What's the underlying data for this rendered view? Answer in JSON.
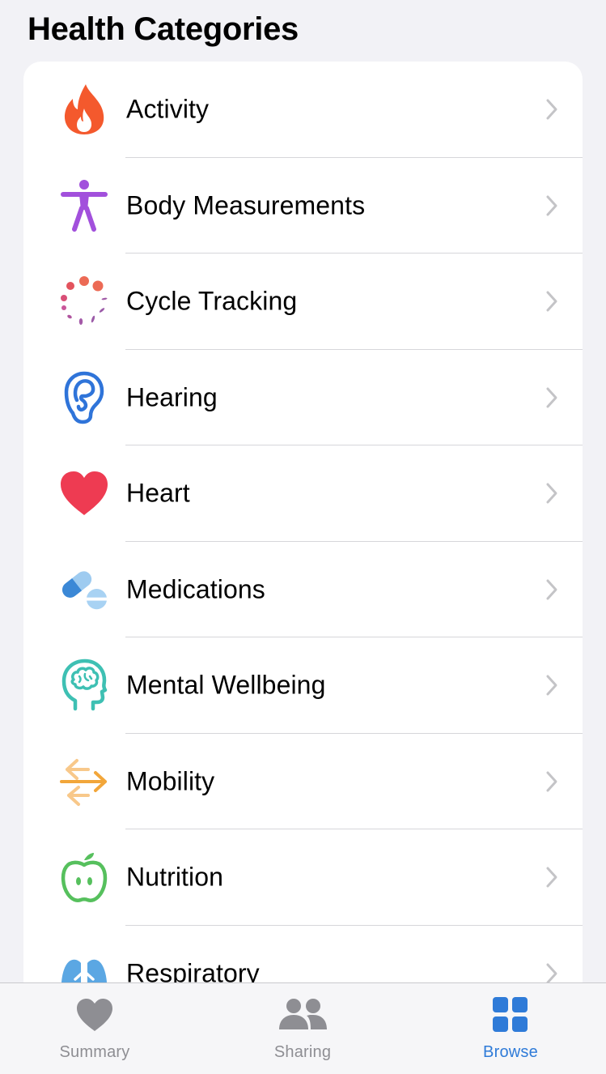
{
  "header": {
    "title": "Health Categories"
  },
  "categories": [
    {
      "label": "Activity",
      "icon": "flame-icon",
      "color": "#f4592d"
    },
    {
      "label": "Body Measurements",
      "icon": "person-figure-icon",
      "color": "#a250dc"
    },
    {
      "label": "Cycle Tracking",
      "icon": "cycle-dots-icon",
      "color": "#e95c53"
    },
    {
      "label": "Hearing",
      "icon": "ear-icon",
      "color": "#2f74d9"
    },
    {
      "label": "Heart",
      "icon": "heart-icon",
      "color": "#ee3b52"
    },
    {
      "label": "Medications",
      "icon": "pills-icon",
      "color": "#5aa5e6"
    },
    {
      "label": "Mental Wellbeing",
      "icon": "brain-head-icon",
      "color": "#3ec0b3"
    },
    {
      "label": "Mobility",
      "icon": "arrows-icon",
      "color": "#f2a63a"
    },
    {
      "label": "Nutrition",
      "icon": "apple-icon",
      "color": "#56c05d"
    },
    {
      "label": "Respiratory",
      "icon": "lungs-icon",
      "color": "#5ba7e3"
    }
  ],
  "tabbar": {
    "tabs": [
      {
        "label": "Summary",
        "icon": "heart-tab-icon",
        "active": false
      },
      {
        "label": "Sharing",
        "icon": "people-icon",
        "active": false
      },
      {
        "label": "Browse",
        "icon": "grid-icon",
        "active": true
      }
    ],
    "active_color": "#2f7bd8",
    "inactive_color": "#8e8e93"
  }
}
